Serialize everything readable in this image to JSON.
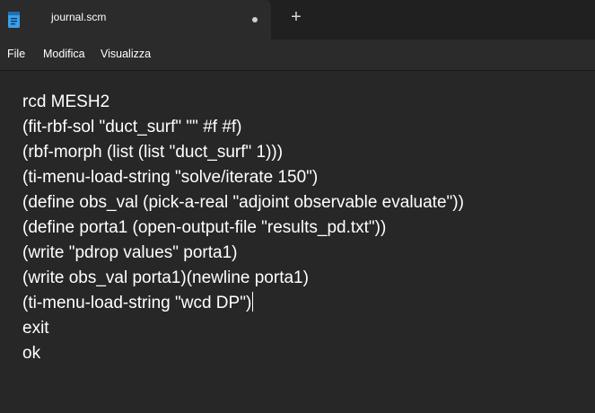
{
  "tab": {
    "title": "journal.scm",
    "new_tab_label": "+"
  },
  "menu": {
    "items": [
      "File",
      "Modifica",
      "Visualizza"
    ]
  },
  "editor": {
    "lines": [
      "rcd MESH2",
      "(fit-rbf-sol \"duct_surf\" \"\" #f #f)",
      "(rbf-morph (list (list \"duct_surf\" 1)))",
      "(ti-menu-load-string \"solve/iterate 150\")",
      "(define obs_val (pick-a-real \"adjoint observable evaluate\"))",
      "(define porta1 (open-output-file \"results_pd.txt\"))",
      "(write \"pdrop values\" porta1)",
      "(write obs_val porta1)(newline porta1)",
      "(ti-menu-load-string \"wcd DP\")",
      "exit",
      "ok"
    ],
    "caret_line": 8
  },
  "colors": {
    "titlebar_bg": "#202020",
    "tab_bg": "#2b2b2b",
    "editor_bg": "#272727",
    "text": "#ffffff",
    "app_icon": "#3aa0e8"
  }
}
